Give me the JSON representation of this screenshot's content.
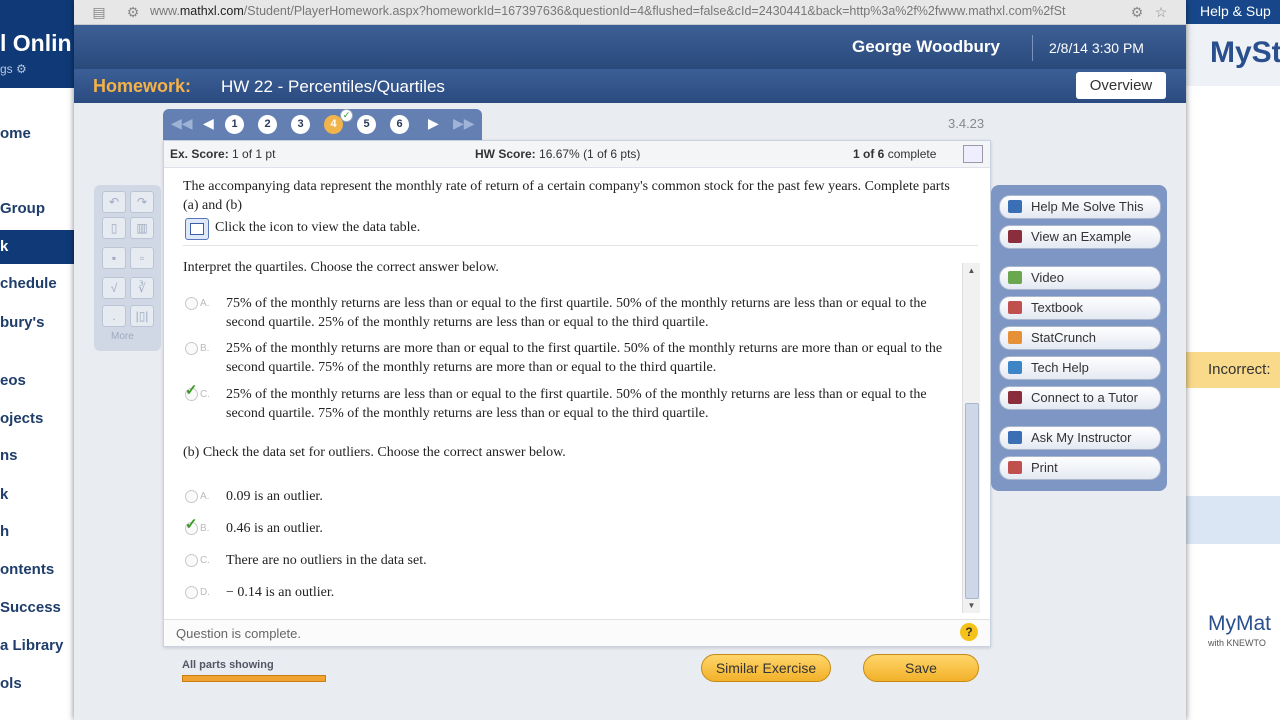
{
  "browser": {
    "url_prefix": "www.",
    "url_domain": "mathxl.com",
    "url_rest": "/Student/PlayerHomework.aspx?homeworkId=167397636&questionId=4&flushed=false&cId=2430441&back=http%3a%2f%2fwww.mathxl.com%2fSt"
  },
  "background_left": {
    "brand": "l Onlin",
    "sub": "gs",
    "items": [
      "ome",
      "Group",
      "k",
      "chedule",
      "bury's",
      "eos",
      "ojects",
      "ns",
      "k",
      "h",
      "ontents",
      "Success",
      "a Library",
      "ols"
    ]
  },
  "background_right": {
    "top_link": "Help & Sup",
    "logo": "MySt",
    "incorrect": "Incorrect:",
    "brand_logo": "MyMat",
    "brand_sub": "with KNEWTO"
  },
  "user": {
    "name": "George Woodbury",
    "datetime": "2/8/14 3:30 PM"
  },
  "homework": {
    "label": "Homework:",
    "title": "HW 22 - Percentiles/Quartiles",
    "overview": "Overview"
  },
  "nav": {
    "numbers": [
      "1",
      "2",
      "3",
      "4",
      "5",
      "6"
    ],
    "current": "4",
    "version": "3.4.23"
  },
  "score": {
    "ex_label": "Ex. Score:",
    "ex_value": "1 of 1 pt",
    "hw_label": "HW Score:",
    "hw_value": "16.67% (1 of 6 pts)",
    "complete_bold": "1 of 6",
    "complete_rest": "complete"
  },
  "question": {
    "intro": "The accompanying data represent the monthly rate of return of a certain company's common stock for the past few years. Complete parts (a) and (b)",
    "table_link": "Click the icon to view the data table.",
    "part_a_prompt": "Interpret the quartiles. Choose the correct answer below.",
    "part_a_options": [
      {
        "letter": "A.",
        "text": "75% of the monthly returns are less than or equal to the first quartile. 50% of the monthly returns are less than or equal to the second quartile. 25% of the monthly returns are less than or equal to the third quartile."
      },
      {
        "letter": "B.",
        "text": "25% of the monthly returns are more than or equal to the first quartile. 50% of the monthly returns are more than or equal to the second quartile. 75% of the monthly returns are more than or equal to the third quartile."
      },
      {
        "letter": "C.",
        "text": "25% of the monthly returns are less than or equal to the first quartile. 50% of the monthly returns are less than or equal to the second quartile. 75% of the monthly returns are less than or equal to the third quartile."
      }
    ],
    "part_a_selected": "C.",
    "part_b_prompt": "(b) Check the data set for outliers. Choose the correct answer below.",
    "part_b_options": [
      {
        "letter": "A.",
        "text": "0.09 is an outlier."
      },
      {
        "letter": "B.",
        "text": "0.46 is an outlier."
      },
      {
        "letter": "C.",
        "text": "There are no outliers in the data set."
      },
      {
        "letter": "D.",
        "text": "− 0.14 is an outlier."
      }
    ],
    "part_b_selected": "B."
  },
  "status": {
    "text": "Question is complete.",
    "help": "?"
  },
  "tools": {
    "more": "More"
  },
  "sidebar": {
    "buttons": [
      {
        "label": "Help Me Solve This",
        "icon": "key-icon",
        "color": "#3b6fb5"
      },
      {
        "label": "View an Example",
        "icon": "example-icon",
        "color": "#8a2d3c"
      },
      {
        "label": "Video",
        "icon": "video-icon",
        "color": "#6aa84f"
      },
      {
        "label": "Textbook",
        "icon": "textbook-icon",
        "color": "#c0504d"
      },
      {
        "label": "StatCrunch",
        "icon": "statcrunch-icon",
        "color": "#e69138"
      },
      {
        "label": "Tech Help",
        "icon": "tech-help-icon",
        "color": "#3d85c6"
      },
      {
        "label": "Connect to a Tutor",
        "icon": "tutor-icon",
        "color": "#8a2d3c"
      },
      {
        "label": "Ask My Instructor",
        "icon": "instructor-icon",
        "color": "#3b6fb5"
      },
      {
        "label": "Print",
        "icon": "print-icon",
        "color": "#c0504d"
      }
    ]
  },
  "footer": {
    "progress_label": "All parts showing",
    "similar": "Similar Exercise",
    "save": "Save"
  },
  "colors": {
    "accent": "#f0b44b",
    "nav_blue": "#2a4a7c",
    "check_green": "#3c9a27"
  }
}
